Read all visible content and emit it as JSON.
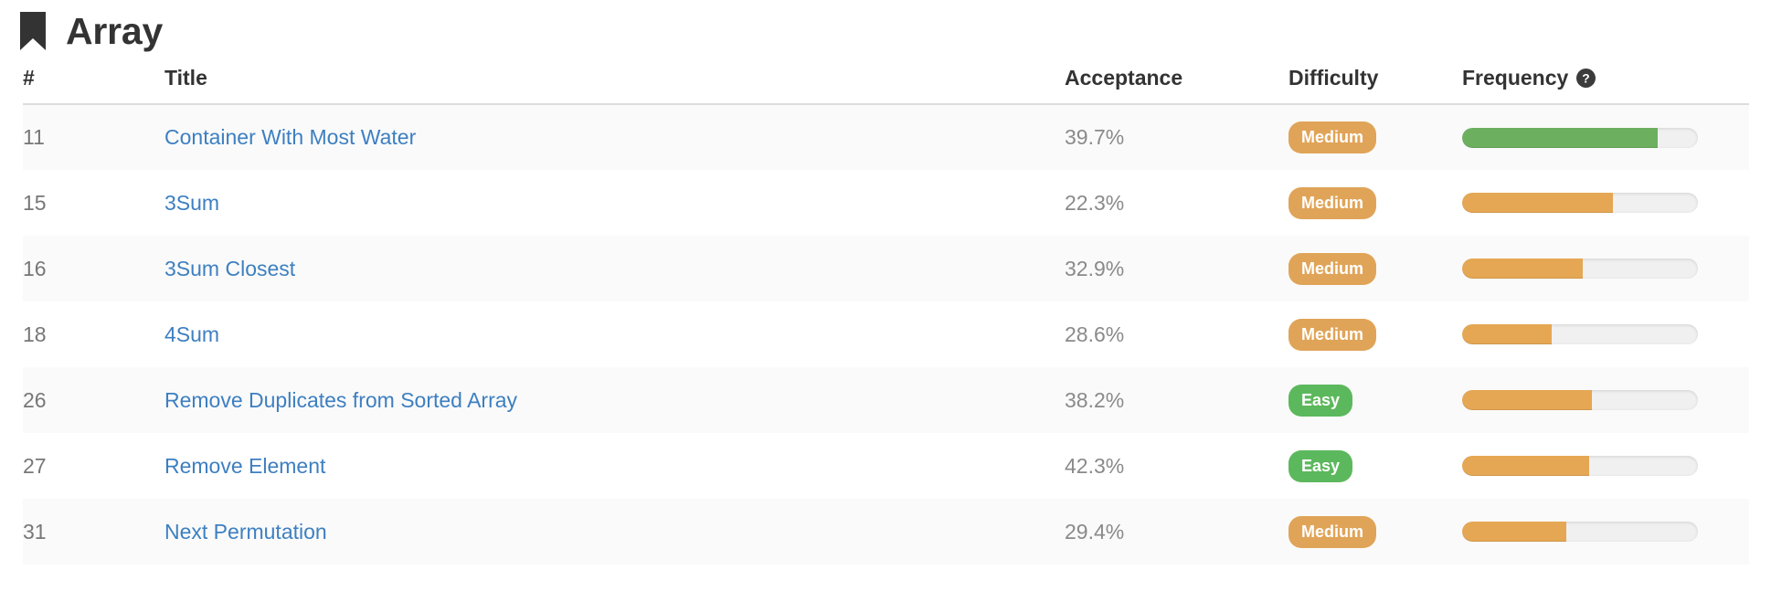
{
  "header": {
    "title": "Array",
    "bookmark_icon": "bookmark-icon"
  },
  "table": {
    "columns": {
      "num": "#",
      "title": "Title",
      "acceptance": "Acceptance",
      "difficulty": "Difficulty",
      "frequency": "Frequency",
      "frequency_help_icon": "question-circle-icon"
    },
    "rows": [
      {
        "num": "11",
        "title": "Container With Most Water",
        "acceptance": "39.7%",
        "difficulty": "Medium",
        "frequency_percent": 83
      },
      {
        "num": "15",
        "title": "3Sum",
        "acceptance": "22.3%",
        "difficulty": "Medium",
        "frequency_percent": 64
      },
      {
        "num": "16",
        "title": "3Sum Closest",
        "acceptance": "32.9%",
        "difficulty": "Medium",
        "frequency_percent": 51
      },
      {
        "num": "18",
        "title": "4Sum",
        "acceptance": "28.6%",
        "difficulty": "Medium",
        "frequency_percent": 38
      },
      {
        "num": "26",
        "title": "Remove Duplicates from Sorted Array",
        "acceptance": "38.2%",
        "difficulty": "Easy",
        "frequency_percent": 55
      },
      {
        "num": "27",
        "title": "Remove Element",
        "acceptance": "42.3%",
        "difficulty": "Easy",
        "frequency_percent": 54
      },
      {
        "num": "31",
        "title": "Next Permutation",
        "acceptance": "29.4%",
        "difficulty": "Medium",
        "frequency_percent": 44
      }
    ]
  },
  "colors": {
    "difficulty_easy": "#5cb85c",
    "difficulty_medium": "#e0a458",
    "difficulty_hard": "#d9534f",
    "bar_green": "#6cb05f",
    "bar_orange": "#e5a753",
    "bar_track": "#f0f0f0",
    "link": "#3d7fc1",
    "text_muted": "#8a8a8a",
    "row_stripe": "#fafafa",
    "heading": "#333333"
  }
}
